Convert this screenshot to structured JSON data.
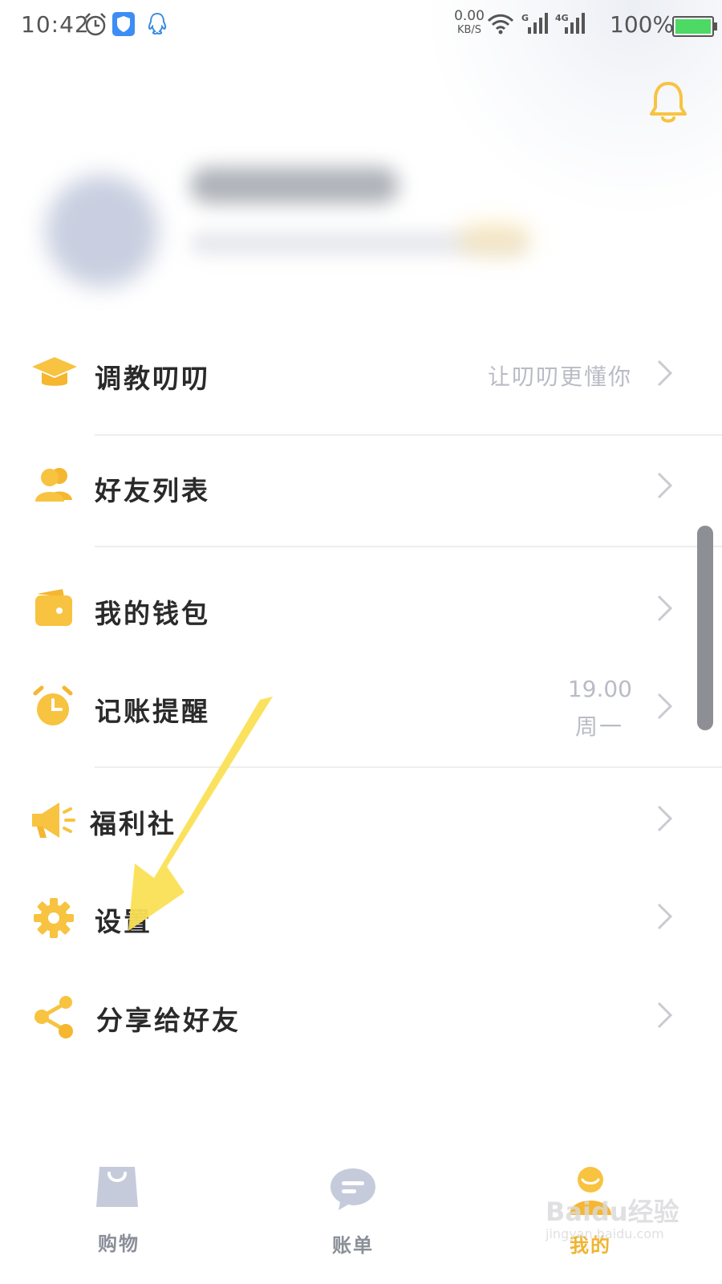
{
  "status_bar": {
    "time": "10:42",
    "net_speed_value": "0.00",
    "net_speed_unit": "KB/S",
    "signal1_label": "G",
    "signal2_label": "4G",
    "battery_percent": "100%",
    "battery_level": 1.0,
    "icons": [
      "alarm-icon",
      "shield-icon",
      "qq-icon",
      "wifi-icon",
      "signal-icon",
      "battery-icon"
    ]
  },
  "header": {
    "bell_icon": "bell-icon",
    "accent_color": "#f7c340"
  },
  "menu": {
    "items": [
      {
        "label": "调教叨叨",
        "hint": "让叨叨更懂你",
        "icon": "graduation-cap-icon"
      },
      {
        "label": "好友列表",
        "hint": "",
        "icon": "friends-icon"
      },
      {
        "label": "我的钱包",
        "hint": "",
        "icon": "wallet-icon"
      },
      {
        "label": "记账提醒",
        "hint_time": "19.00",
        "hint_day": "周一",
        "icon": "alarm-clock-icon"
      },
      {
        "label": "福利社",
        "hint": "",
        "icon": "megaphone-icon"
      },
      {
        "label": "设置",
        "hint": "",
        "icon": "gear-icon"
      },
      {
        "label": "分享给好友",
        "hint": "",
        "icon": "share-icon"
      }
    ]
  },
  "bottom_nav": {
    "tabs": [
      {
        "label": "购物",
        "icon": "shopping-bag-icon"
      },
      {
        "label": "账单",
        "icon": "chat-bubble-icon"
      },
      {
        "label": "我的",
        "icon": "profile-icon",
        "active": true
      }
    ]
  },
  "watermark": {
    "text": "Baidu经验",
    "url": "jingyan.baidu.com"
  }
}
